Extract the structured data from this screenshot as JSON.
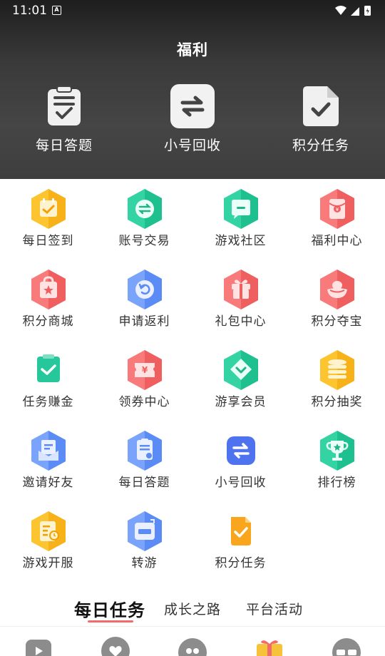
{
  "status": {
    "time": "11:01",
    "a_badge": "A"
  },
  "header": {
    "title": "福利",
    "quick_items": [
      {
        "label": "每日答题",
        "icon": "quiz-clipboard-icon"
      },
      {
        "label": "小号回收",
        "icon": "swap-arrows-icon"
      },
      {
        "label": "积分任务",
        "icon": "task-doc-check-icon"
      }
    ]
  },
  "grid": [
    {
      "label": "每日签到",
      "icon": "calendar-check-icon",
      "color": "#f9b81e"
    },
    {
      "label": "账号交易",
      "icon": "exchange-icon",
      "color": "#26c79a"
    },
    {
      "label": "游戏社区",
      "icon": "chat-bubble-icon",
      "color": "#26c79a"
    },
    {
      "label": "福利中心",
      "icon": "red-envelope-icon",
      "color": "#f36363"
    },
    {
      "label": "积分商城",
      "icon": "shopping-bag-icon",
      "color": "#f36363"
    },
    {
      "label": "申请返利",
      "icon": "refund-icon",
      "color": "#5b8cf5"
    },
    {
      "label": "礼包中心",
      "icon": "gift-box-icon",
      "color": "#f36363"
    },
    {
      "label": "积分夺宝",
      "icon": "treasure-icon",
      "color": "#f36363"
    },
    {
      "label": "任务赚金",
      "icon": "clipboard-check-icon",
      "color": "#26c79a"
    },
    {
      "label": "领券中心",
      "icon": "coupon-icon",
      "color": "#f36363"
    },
    {
      "label": "游享会员",
      "icon": "vip-diamond-icon",
      "color": "#26c79a"
    },
    {
      "label": "积分抽奖",
      "icon": "coin-stack-icon",
      "color": "#f9b81e"
    },
    {
      "label": "邀请好友",
      "icon": "invite-mail-icon",
      "color": "#5b8cf5"
    },
    {
      "label": "每日答题",
      "icon": "quiz-clipboard-icon",
      "color": "#5b8cf5"
    },
    {
      "label": "小号回收",
      "icon": "swap-arrows-icon",
      "color": "#5b8cf5"
    },
    {
      "label": "排行榜",
      "icon": "trophy-icon",
      "color": "#26c79a"
    },
    {
      "label": "游戏开服",
      "icon": "server-open-icon",
      "color": "#f9b81e"
    },
    {
      "label": "转游",
      "icon": "transfer-game-icon",
      "color": "#5b8cf5"
    },
    {
      "label": "积分任务",
      "icon": "task-doc-check-icon",
      "color": "#f9a61e"
    }
  ],
  "tabs": [
    {
      "label": "每日任务",
      "active": true
    },
    {
      "label": "成长之路",
      "active": false
    },
    {
      "label": "平台活动",
      "active": false
    }
  ],
  "bottom_nav": [
    {
      "name": "home-game-icon"
    },
    {
      "name": "favorite-icon"
    },
    {
      "name": "community-icon"
    },
    {
      "name": "gift-icon"
    },
    {
      "name": "profile-glasses-icon"
    }
  ]
}
